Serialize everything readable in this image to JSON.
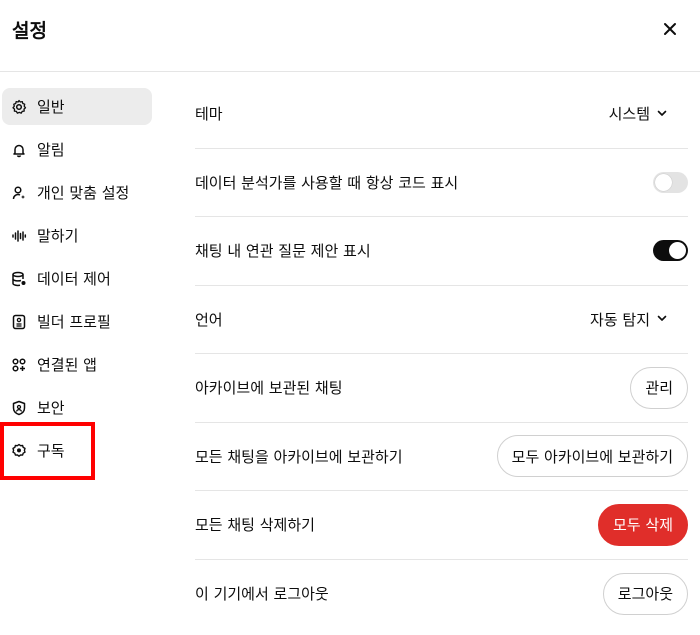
{
  "header": {
    "title": "설정",
    "close_icon": "close-icon"
  },
  "sidebar": {
    "items": [
      {
        "label": "일반",
        "icon": "gear-icon",
        "active": true
      },
      {
        "label": "알림",
        "icon": "bell-icon"
      },
      {
        "label": "개인 맞춤 설정",
        "icon": "personalize-icon"
      },
      {
        "label": "말하기",
        "icon": "waveform-icon"
      },
      {
        "label": "데이터 제어",
        "icon": "database-icon"
      },
      {
        "label": "빌더 프로필",
        "icon": "id-card-icon"
      },
      {
        "label": "연결된 앱",
        "icon": "apps-icon"
      },
      {
        "label": "보안",
        "icon": "shield-icon"
      },
      {
        "label": "구독",
        "icon": "badge-icon"
      }
    ]
  },
  "settings": {
    "theme": {
      "label": "테마",
      "value": "시스템"
    },
    "always_show_code": {
      "label": "데이터 분석가를 사용할 때 항상 코드 표시",
      "enabled": false
    },
    "show_followups": {
      "label": "채팅 내 연관 질문 제안 표시",
      "enabled": true
    },
    "language": {
      "label": "언어",
      "value": "자동 탐지"
    },
    "archived": {
      "label": "아카이브에 보관된 채팅",
      "button": "관리"
    },
    "archive_all": {
      "label": "모든 채팅을 아카이브에 보관하기",
      "button": "모두 아카이브에 보관하기"
    },
    "delete_all": {
      "label": "모든 채팅 삭제하기",
      "button": "모두 삭제"
    },
    "logout": {
      "label": "이 기기에서 로그아웃",
      "button": "로그아웃"
    }
  },
  "colors": {
    "danger": "#e02e2a",
    "highlight": "#ff0000",
    "active_bg": "#ececec"
  }
}
